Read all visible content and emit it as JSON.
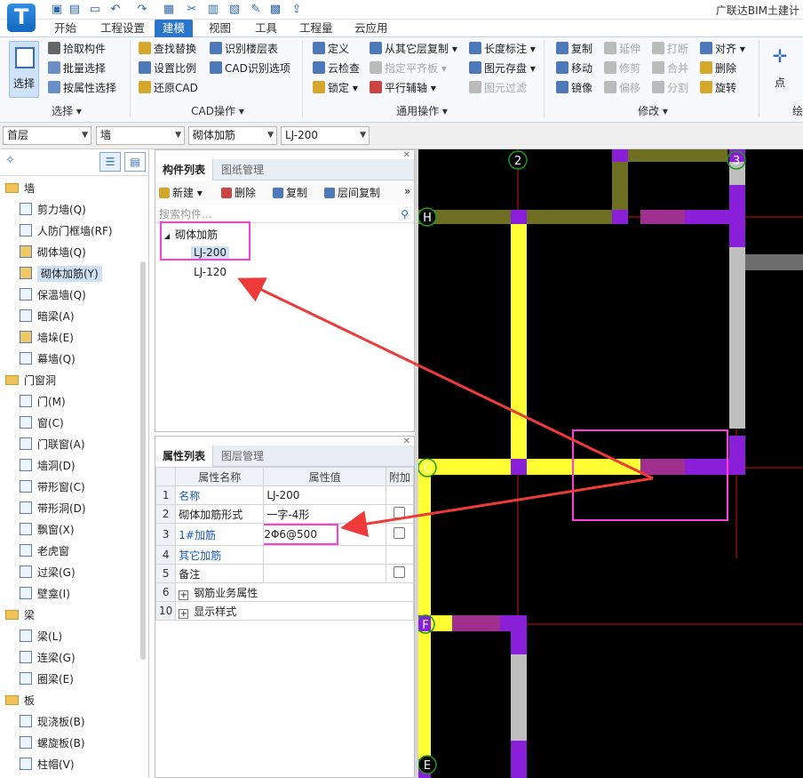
{
  "app": {
    "title": "广联达BIM土建计",
    "logo": "T"
  },
  "quick_access": [
    "save-icon",
    "open-icon",
    "new-icon",
    "undo-icon",
    "redo-icon",
    "print-icon",
    "cut-icon",
    "brush-icon",
    "grid-icon",
    "export-icon"
  ],
  "menu": {
    "items": [
      "开始",
      "工程设置",
      "建模",
      "视图",
      "工具",
      "工程量",
      "云应用"
    ],
    "active": "建模"
  },
  "ribbon": {
    "select": {
      "label": "选择",
      "tools": [
        "拾取构件",
        "批量选择",
        "按属性选择"
      ],
      "group": "选择"
    },
    "cad": {
      "tools": [
        "查找替换",
        "识别楼层表",
        "设置比例",
        "CAD识别选项",
        "还原CAD"
      ],
      "group": "CAD操作"
    },
    "common": {
      "tools": [
        "定义",
        "从其它层复制",
        "长度标注",
        "云检查",
        "指定平齐板",
        "图元存盘",
        "锁定",
        "平行辅轴",
        "图元过滤"
      ],
      "group": "通用操作"
    },
    "modify": {
      "tools": [
        "复制",
        "延伸",
        "打断",
        "对齐",
        "移动",
        "修剪",
        "合并",
        "删除",
        "镜像",
        "偏移",
        "分割",
        "旋转"
      ],
      "group": "修改"
    },
    "draw": {
      "tools": [
        "点"
      ],
      "group": "绘"
    }
  },
  "combos": {
    "floor": "首层",
    "type": "墙",
    "subtype": "砌体加筋",
    "component": "LJ-200"
  },
  "tree": {
    "categories": [
      {
        "label": "墙",
        "items": [
          "剪力墙(Q)",
          "人防门框墙(RF)",
          "砌体墙(Q)",
          "砌体加筋(Y)",
          "保温墙(Q)",
          "暗梁(A)",
          "墙垛(E)",
          "幕墙(Q)"
        ]
      },
      {
        "label": "门窗洞",
        "items": [
          "门(M)",
          "窗(C)",
          "门联窗(A)",
          "墙洞(D)",
          "带形窗(C)",
          "带形洞(D)",
          "飘窗(X)",
          "老虎窗",
          "过梁(G)",
          "壁龛(I)"
        ]
      },
      {
        "label": "梁",
        "items": [
          "梁(L)",
          "连梁(G)",
          "圈梁(E)"
        ]
      },
      {
        "label": "板",
        "items": [
          "现浇板(B)",
          "螺旋板(B)",
          "柱帽(V)"
        ]
      }
    ],
    "selected": "砌体加筋(Y)"
  },
  "component_panel": {
    "tabs": [
      "构件列表",
      "图纸管理"
    ],
    "tools": [
      "新建",
      "删除",
      "复制",
      "层间复制"
    ],
    "search_placeholder": "搜索构件...",
    "root": "砌体加筋",
    "items": [
      "LJ-200",
      "LJ-120"
    ],
    "selected": "LJ-200"
  },
  "property_panel": {
    "tabs": [
      "属性列表",
      "图层管理"
    ],
    "headers": [
      "属性名称",
      "属性值",
      "附加"
    ],
    "rows": [
      {
        "no": "1",
        "name": "名称",
        "value": "LJ-200",
        "blue": true,
        "check": false
      },
      {
        "no": "2",
        "name": "砌体加筋形式",
        "value": "一字-4形",
        "blue": false,
        "check": true
      },
      {
        "no": "3",
        "name": "1#加筋",
        "value": "2Φ6@500",
        "blue": true,
        "check": true
      },
      {
        "no": "4",
        "name": "其它加筋",
        "value": "",
        "blue": true,
        "check": false
      },
      {
        "no": "5",
        "name": "备注",
        "value": "",
        "blue": false,
        "check": true
      },
      {
        "no": "6",
        "name": "钢筋业务属性",
        "value": "",
        "blue": false,
        "check": false,
        "group": true
      },
      {
        "no": "10",
        "name": "显示样式",
        "value": "",
        "blue": false,
        "check": false,
        "group": true
      }
    ]
  },
  "canvas": {
    "axes": [
      "2",
      "3",
      "H",
      "C",
      "F",
      "E"
    ]
  },
  "colors": {
    "accent": "#2a75c9",
    "highlight": "#ff3bdc",
    "arrow": "#ee3a3a",
    "wall_yellow": "#ffff33",
    "wall_purple": "#8a1fd9",
    "wall_olive": "#6f6f24",
    "wall_grey": "#bfbfbf"
  }
}
